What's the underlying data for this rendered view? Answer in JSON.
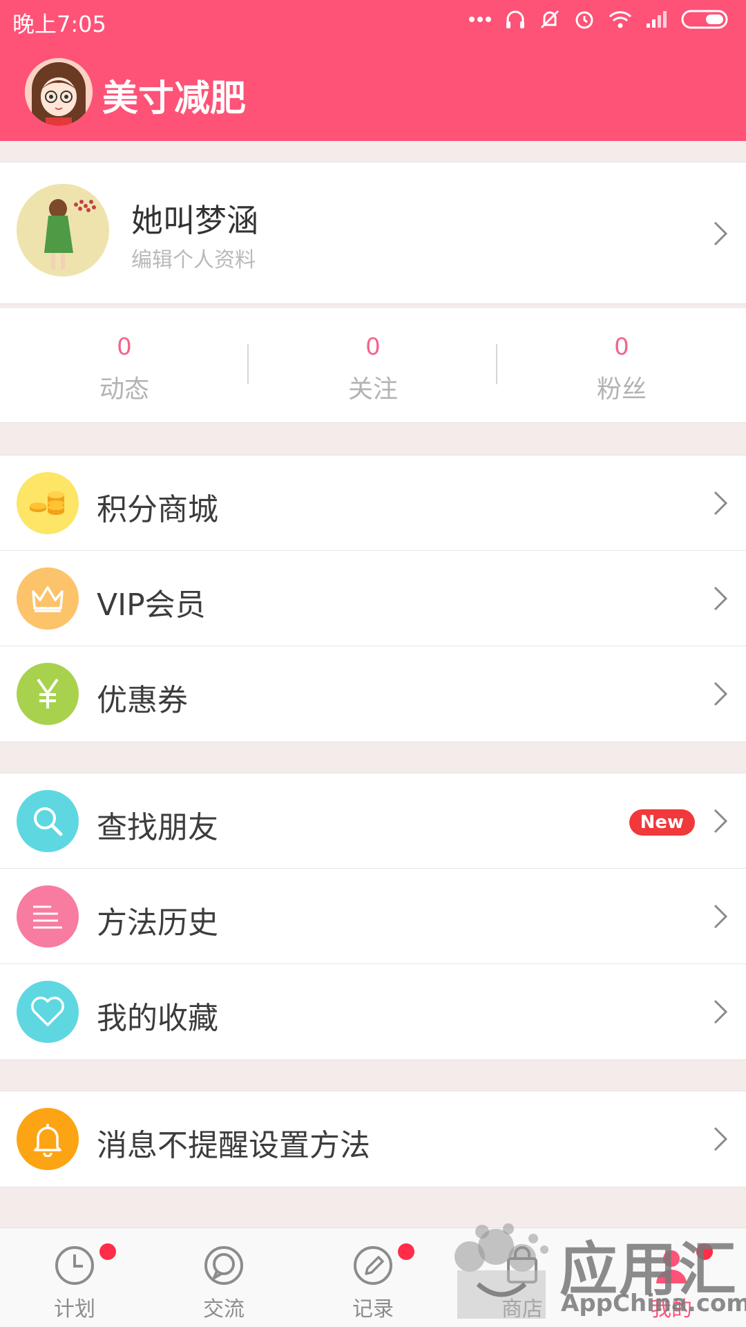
{
  "status_bar": {
    "time": "晚上7:05"
  },
  "header": {
    "title": "美寸减肥"
  },
  "profile": {
    "name": "她叫梦涵",
    "edit_label": "编辑个人资料"
  },
  "stats": [
    {
      "value": "0",
      "label": "动态"
    },
    {
      "value": "0",
      "label": "关注"
    },
    {
      "value": "0",
      "label": "粉丝"
    }
  ],
  "menu_group_1": [
    {
      "label": "积分商城",
      "icon": "coins-icon",
      "color": "#fde566"
    },
    {
      "label": "VIP会员",
      "icon": "crown-icon",
      "color": "#fcc36b"
    },
    {
      "label": "优惠券",
      "icon": "yen-icon",
      "color": "#a8d24e"
    }
  ],
  "menu_group_2": [
    {
      "label": "查找朋友",
      "icon": "search-icon",
      "color": "#5ed7e1",
      "badge": "New"
    },
    {
      "label": "方法历史",
      "icon": "list-icon",
      "color": "#f87ba0"
    },
    {
      "label": "我的收藏",
      "icon": "heart-icon",
      "color": "#5ed7e1"
    }
  ],
  "menu_group_3": [
    {
      "label": "消息不提醒设置方法",
      "icon": "bell-icon",
      "color": "#fca413"
    }
  ],
  "bottom_nav": [
    {
      "label": "计划",
      "icon": "clock-icon",
      "dot": true
    },
    {
      "label": "交流",
      "icon": "chat-icon",
      "dot": false
    },
    {
      "label": "记录",
      "icon": "pencil-icon",
      "dot": true
    },
    {
      "label": "商店",
      "icon": "bag-icon",
      "dot": false
    },
    {
      "label": "我的",
      "icon": "person-icon",
      "dot": true,
      "active": true
    }
  ],
  "watermark": {
    "title": "应用汇",
    "subtitle": "AppChina.com"
  },
  "colors": {
    "brand": "#fe5277",
    "badge": "#f1383b",
    "background": "#f3eceb"
  }
}
